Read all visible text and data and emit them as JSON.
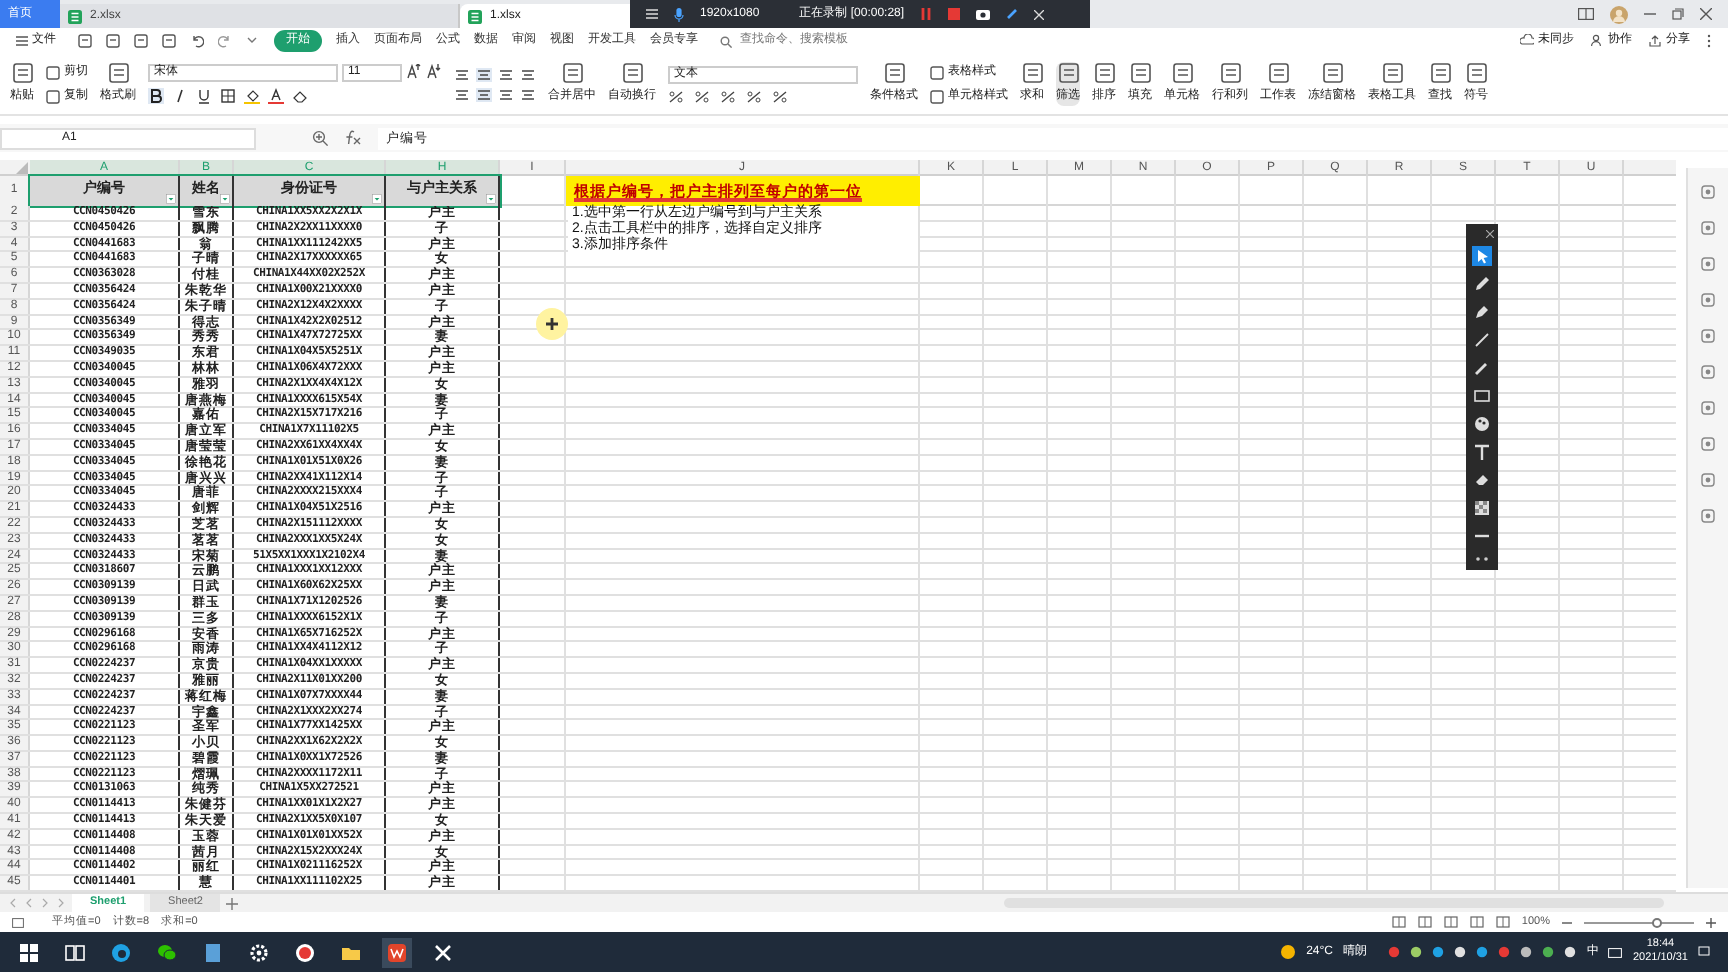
{
  "title_bar": {
    "tabs": [
      {
        "label": "首页",
        "selected": false,
        "kind": "home"
      },
      {
        "label": "2.xlsx",
        "selected": false,
        "kind": "file"
      },
      {
        "label": "1.xlsx",
        "selected": true,
        "kind": "file"
      }
    ]
  },
  "recording_bar": {
    "resolution": "1920x1080",
    "status": "正在录制 [00:00:28]"
  },
  "menu": {
    "items": [
      {
        "label": "文件",
        "selected": false
      },
      {
        "label": "开始",
        "selected": true
      },
      {
        "label": "插入",
        "selected": false
      },
      {
        "label": "页面布局",
        "selected": false
      },
      {
        "label": "公式",
        "selected": false
      },
      {
        "label": "数据",
        "selected": false
      },
      {
        "label": "审阅",
        "selected": false
      },
      {
        "label": "视图",
        "selected": false
      },
      {
        "label": "开发工具",
        "selected": false
      },
      {
        "label": "会员专享",
        "selected": false
      }
    ],
    "search": {
      "placeholder": "查找命令、搜索模板"
    },
    "actions": [
      "未同步",
      "协作",
      "分享"
    ]
  },
  "ribbon": {
    "font": "宋体",
    "font_size": "11",
    "number_format": "文本",
    "tools": [
      "粘贴",
      "剪切",
      "复制",
      "格式刷",
      "合并居中",
      "自动换行",
      "条件格式",
      "表格样式",
      "单元格样式",
      "求和",
      "筛选",
      "排序",
      "填充",
      "单元格",
      "行和列",
      "工作表",
      "冻结窗格",
      "表格工具",
      "查找",
      "符号"
    ]
  },
  "formula_bar": {
    "cell": "A1",
    "content": "户编号"
  },
  "sheet": {
    "columns": [
      "A",
      "B",
      "C",
      "H",
      "I",
      "J",
      "K",
      "L",
      "M",
      "N",
      "O",
      "P",
      "Q",
      "R",
      "S",
      "T",
      "U"
    ],
    "header_selected": true,
    "header_row": {
      "n": "1",
      "cells": [
        "户编号",
        "姓名",
        "身份证号",
        "与户主关系"
      ]
    },
    "rows": [
      {
        "n": "2",
        "cells": [
          "CCN0450426",
          "雪东",
          "CHINA1XX5XX2X2X1X",
          "户主"
        ]
      },
      {
        "n": "3",
        "cells": [
          "CCN0450426",
          "飘腾",
          "CHINA2X2XX11XXXX0",
          "子"
        ]
      },
      {
        "n": "4",
        "cells": [
          "CCN0441683",
          "翁",
          "CHINA1XX111242XX5",
          "户主"
        ]
      },
      {
        "n": "5",
        "cells": [
          "CCN0441683",
          "子晴",
          "CHINA2X17XXXXXX65",
          "女"
        ]
      },
      {
        "n": "6",
        "cells": [
          "CCN0363028",
          "付桂",
          "CHINA1X44XX02X252X",
          "户主"
        ]
      },
      {
        "n": "7",
        "cells": [
          "CCN0356424",
          "朱乾华",
          "CHINA1X00X21XXXX0",
          "户主"
        ]
      },
      {
        "n": "8",
        "cells": [
          "CCN0356424",
          "朱子晴",
          "CHINA2X12X4X2XXXX",
          "子"
        ]
      },
      {
        "n": "9",
        "cells": [
          "CCN0356349",
          "得志",
          "CHINA1X42X2X02512",
          "户主"
        ]
      },
      {
        "n": "10",
        "cells": [
          "CCN0356349",
          "秀秀",
          "CHINA1X47X72725XX",
          "妻"
        ]
      },
      {
        "n": "11",
        "cells": [
          "CCN0349035",
          "东君",
          "CHINA1X04X5X5251X",
          "户主"
        ]
      },
      {
        "n": "12",
        "cells": [
          "CCN0340045",
          "林林",
          "CHINA1X06X4X72XXX",
          "户主"
        ]
      },
      {
        "n": "13",
        "cells": [
          "CCN0340045",
          "雅羽",
          "CHINA2X1XX4X4X12X",
          "女"
        ]
      },
      {
        "n": "14",
        "cells": [
          "CCN0340045",
          "唐燕梅",
          "CHINA1XXXX615X54X",
          "妻"
        ]
      },
      {
        "n": "15",
        "cells": [
          "CCN0340045",
          "嘉佑",
          "CHINA2X15X717X216",
          "子"
        ]
      },
      {
        "n": "16",
        "cells": [
          "CCN0334045",
          "唐立军",
          "CHINA1X7X11102X5",
          "户主"
        ]
      },
      {
        "n": "17",
        "cells": [
          "CCN0334045",
          "唐莹莹",
          "CHINA2XX61XX4XX4X",
          "女"
        ]
      },
      {
        "n": "18",
        "cells": [
          "CCN0334045",
          "徐艳花",
          "CHINA1X01X51X0X26",
          "妻"
        ]
      },
      {
        "n": "19",
        "cells": [
          "CCN0334045",
          "唐兴兴",
          "CHINA2XX41X112X14",
          "子"
        ]
      },
      {
        "n": "20",
        "cells": [
          "CCN0334045",
          "唐菲",
          "CHINA2XXXX215XXX4",
          "子"
        ]
      },
      {
        "n": "21",
        "cells": [
          "CCN0324433",
          "剑辉",
          "CHINA1X04X51X2516",
          "户主"
        ]
      },
      {
        "n": "22",
        "cells": [
          "CCN0324433",
          "芝茗",
          "CHINA2X151112XXXX",
          "女"
        ]
      },
      {
        "n": "23",
        "cells": [
          "CCN0324433",
          "茗茗",
          "CHINA2XXX1XX5X24X",
          "女"
        ]
      },
      {
        "n": "24",
        "cells": [
          "CCN0324433",
          "宋菊",
          "51X5XX1XXX1X2102X4",
          "妻"
        ]
      },
      {
        "n": "25",
        "cells": [
          "CCN0318607",
          "云鹏",
          "CHINA1XXX1XX12XXX",
          "户主"
        ]
      },
      {
        "n": "26",
        "cells": [
          "CCN0309139",
          "日武",
          "CHINA1X60X62X25XX",
          "户主"
        ]
      },
      {
        "n": "27",
        "cells": [
          "CCN0309139",
          "群玉",
          "CHINA1X71X1202526",
          "妻"
        ]
      },
      {
        "n": "28",
        "cells": [
          "CCN0309139",
          "三多",
          "CHINA1XXXX6152X1X",
          "子"
        ]
      },
      {
        "n": "29",
        "cells": [
          "CCN0296168",
          "安香",
          "CHINA1X65X716252X",
          "户主"
        ]
      },
      {
        "n": "30",
        "cells": [
          "CCN0296168",
          "雨涛",
          "CHINA1XX4X4112X12",
          "子"
        ]
      },
      {
        "n": "31",
        "cells": [
          "CCN0224237",
          "京贵",
          "CHINA1X04XX1XXXXX",
          "户主"
        ]
      },
      {
        "n": "32",
        "cells": [
          "CCN0224237",
          "雅丽",
          "CHINA2X11X01XX200",
          "女"
        ]
      },
      {
        "n": "33",
        "cells": [
          "CCN0224237",
          "蒋红梅",
          "CHINA1X07X7XXXX44",
          "妻"
        ]
      },
      {
        "n": "34",
        "cells": [
          "CCN0224237",
          "宇鑫",
          "CHINA2X1XXX2XX274",
          "子"
        ]
      },
      {
        "n": "35",
        "cells": [
          "CCN0221123",
          "圣军",
          "CHINA1X77XX1425XX",
          "户主"
        ]
      },
      {
        "n": "36",
        "cells": [
          "CCN0221123",
          "小贝",
          "CHINA2XX1X62X2X2X",
          "女"
        ]
      },
      {
        "n": "37",
        "cells": [
          "CCN0221123",
          "碧霞",
          "CHINA1X0XX1X72526",
          "妻"
        ]
      },
      {
        "n": "38",
        "cells": [
          "CCN0221123",
          "熠珮",
          "CHINA2XXXX1172X11",
          "子"
        ]
      },
      {
        "n": "39",
        "cells": [
          "CCN0131063",
          "纯秀",
          "CHINA1X5XX272521",
          "户主"
        ]
      },
      {
        "n": "40",
        "cells": [
          "CCN0114413",
          "朱健芬",
          "CHINA1XX01X1X2X27",
          "户主"
        ]
      },
      {
        "n": "41",
        "cells": [
          "CCN0114413",
          "朱天爱",
          "CHINA2X1XX5X0X107",
          "女"
        ]
      },
      {
        "n": "42",
        "cells": [
          "CCN0114408",
          "玉蓉",
          "CHINA1X01X01XX52X",
          "户主"
        ]
      },
      {
        "n": "43",
        "cells": [
          "CCN0114408",
          "茜月",
          "CHINA2X15X2XXX24X",
          "女"
        ]
      },
      {
        "n": "44",
        "cells": [
          "CCN0114402",
          "丽红",
          "CHINA1X021116252X",
          "户主"
        ]
      },
      {
        "n": "45",
        "cells": [
          "CCN0114401",
          "慧",
          "CHINA1XX111102X25",
          "户主"
        ]
      }
    ],
    "notes": {
      "title": "根据户编号，把户主排列至每户的第一位",
      "lines": [
        "1.选中第一行从左边户编号到与户主关系",
        "2.点击工具栏中的排序，选择自定义排序",
        "3.添加排序条件"
      ]
    }
  },
  "drawing_toolbar": {
    "tools": [
      {
        "kind": "pointer",
        "selected": true
      },
      {
        "kind": "pen",
        "selected": false
      },
      {
        "kind": "marker",
        "selected": false
      },
      {
        "kind": "line",
        "selected": false
      },
      {
        "kind": "brush",
        "selected": false
      },
      {
        "kind": "rect",
        "selected": false
      },
      {
        "kind": "palette",
        "selected": false
      },
      {
        "kind": "text",
        "selected": false
      },
      {
        "kind": "eraser",
        "selected": false
      },
      {
        "kind": "mosaic",
        "selected": false
      },
      {
        "kind": "thickness",
        "selected": false
      }
    ]
  },
  "sheet_tabs": [
    {
      "label": "Sheet1",
      "selected": true
    },
    {
      "label": "Sheet2",
      "selected": false
    }
  ],
  "status_bar": {
    "stats": [
      "平均值=0",
      "计数=8",
      "求和=0"
    ],
    "zoom": "100%",
    "zoom_slider": {
      "level": 0.68
    }
  },
  "taskbar": {
    "temperature": "24°C",
    "weather": "晴朗",
    "ime": "中",
    "time": "18:44",
    "date": "2021/10/31"
  }
}
